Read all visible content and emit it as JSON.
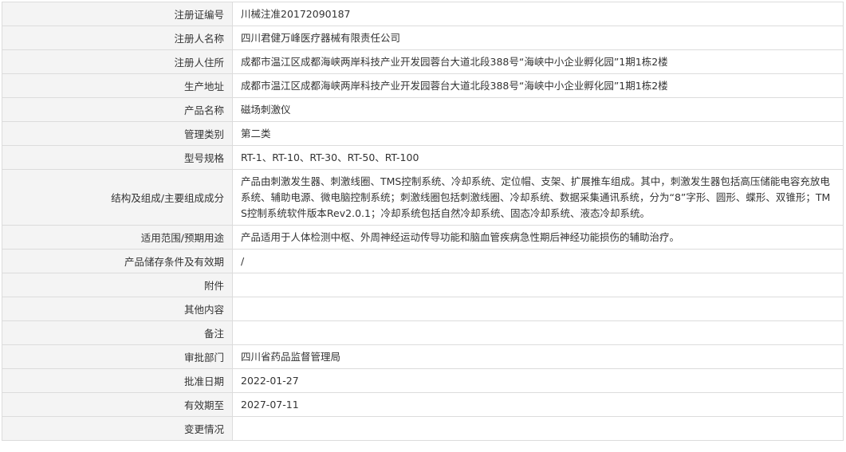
{
  "rows": [
    {
      "label": "注册证编号",
      "value": "川械注准20172090187"
    },
    {
      "label": "注册人名称",
      "value": "四川君健万峰医疗器械有限责任公司"
    },
    {
      "label": "注册人住所",
      "value": "成都市温江区成都海峡两岸科技产业开发园蓉台大道北段388号“海峡中小企业孵化园”1期1栋2楼"
    },
    {
      "label": "生产地址",
      "value": "成都市温江区成都海峡两岸科技产业开发园蓉台大道北段388号“海峡中小企业孵化园”1期1栋2楼"
    },
    {
      "label": "产品名称",
      "value": "磁场刺激仪"
    },
    {
      "label": "管理类别",
      "value": "第二类"
    },
    {
      "label": "型号规格",
      "value": "RT-1、RT-10、RT-30、RT-50、RT-100"
    },
    {
      "label": "结构及组成/主要组成成分",
      "value": "产品由刺激发生器、刺激线圈、TMS控制系统、冷却系统、定位帽、支架、扩展推车组成。其中，刺激发生器包括高压储能电容充放电系统、辅助电源、微电脑控制系统；刺激线圈包括刺激线圈、冷却系统、数据采集通讯系统，分为“8”字形、圆形、蝶形、双锥形；TMS控制系统软件版本Rev2.0.1；冷却系统包括自然冷却系统、固态冷却系统、液态冷却系统。"
    },
    {
      "label": "适用范围/预期用途",
      "value": "产品适用于人体检测中枢、外周神经运动传导功能和脑血管疾病急性期后神经功能损伤的辅助治疗。"
    },
    {
      "label": "产品储存条件及有效期",
      "value": "/"
    },
    {
      "label": "附件",
      "value": ""
    },
    {
      "label": "其他内容",
      "value": ""
    },
    {
      "label": "备注",
      "value": ""
    },
    {
      "label": "审批部门",
      "value": "四川省药品监督管理局"
    },
    {
      "label": "批准日期",
      "value": "2022-01-27"
    },
    {
      "label": "有效期至",
      "value": "2027-07-11"
    },
    {
      "label": "变更情况",
      "value": ""
    }
  ]
}
